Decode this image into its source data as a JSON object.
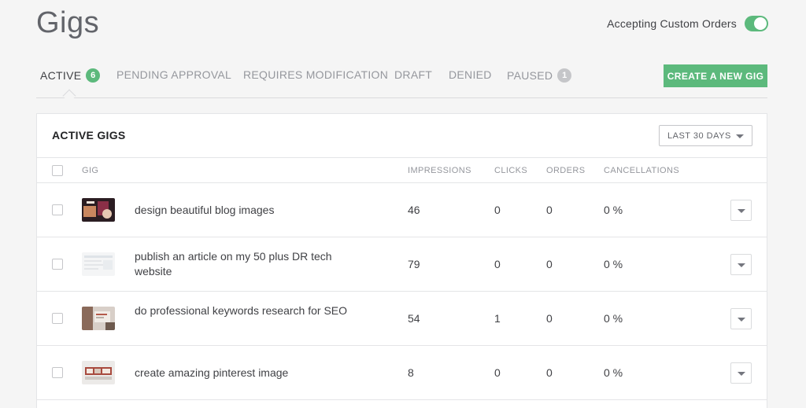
{
  "page": {
    "title": "Gigs"
  },
  "colors": {
    "accent": "#5cb97c",
    "badge_inactive": "#c5c6c9",
    "text": "#404145",
    "muted": "#95979d"
  },
  "toggle": {
    "label": "Accepting Custom Orders",
    "on": true
  },
  "tabs": [
    {
      "label": "ACTIVE",
      "count": "6",
      "active": true
    },
    {
      "label": "PENDING APPROVAL"
    },
    {
      "label": "REQUIRES MODIFICATION"
    },
    {
      "label": "DRAFT"
    },
    {
      "label": "DENIED"
    },
    {
      "label": "PAUSED",
      "count": "1"
    }
  ],
  "create_button": {
    "label": "CREATE A NEW GIG"
  },
  "panel": {
    "title": "ACTIVE GIGS",
    "period": {
      "selected": "LAST 30 DAYS"
    },
    "columns": [
      "GIG",
      "IMPRESSIONS",
      "CLICKS",
      "ORDERS",
      "CANCELLATIONS"
    ],
    "rows": [
      {
        "title": "design beautiful blog images",
        "impressions": "46",
        "clicks": "0",
        "orders": "0",
        "cancellations": "0 %"
      },
      {
        "title": "publish an article on my 50 plus DR tech website",
        "impressions": "79",
        "clicks": "0",
        "orders": "0",
        "cancellations": "0 %"
      },
      {
        "title": "do professional keywords research for SEO",
        "impressions": "54",
        "clicks": "1",
        "orders": "0",
        "cancellations": "0 %"
      },
      {
        "title": "create amazing pinterest image",
        "impressions": "8",
        "clicks": "0",
        "orders": "0",
        "cancellations": "0 %"
      }
    ]
  }
}
